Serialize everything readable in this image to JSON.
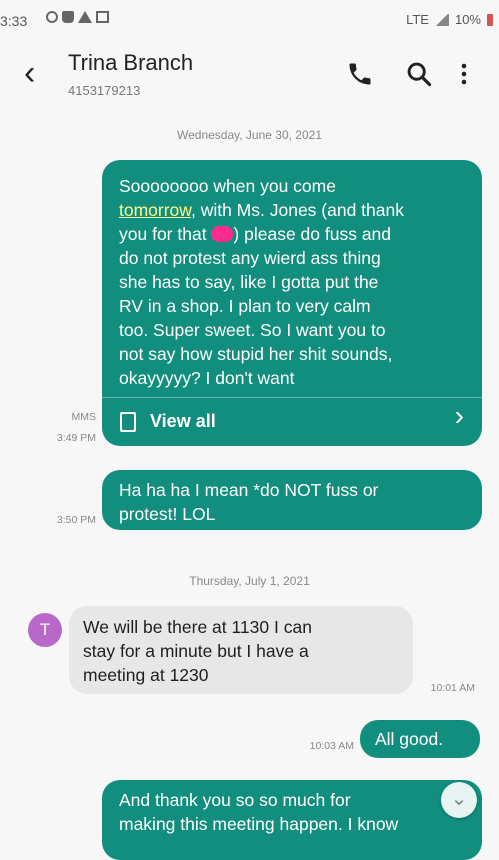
{
  "status_bar": {
    "time": "3:33",
    "network": "LTE",
    "battery": "10%"
  },
  "header": {
    "contact_name": "Trina Branch",
    "phone_number": "4153179213",
    "icons": [
      "back-icon",
      "phone-icon",
      "search-icon",
      "more-vertical-icon"
    ]
  },
  "conversation": {
    "date_1": "Wednesday, June 30, 2021",
    "message_1": {
      "line_1": "Soooooooo when you come",
      "link_text": "tomorrow",
      "after_link": ", with Ms. Jones (and thank",
      "line_3_prefix": "you for that ",
      "line_3_suffix": ") please do fuss and",
      "line_4": "do not protest any wierd ass thing",
      "line_5": "she has to say, like I gotta put the",
      "line_6": "RV in a shop.  I plan to very calm",
      "line_7": "too.  Super sweet.  So I want you to",
      "line_8": "not say how stupid her shit sounds,",
      "line_9": "okayyyyy?  I don't want",
      "view_all_label": "View all",
      "type": "MMS",
      "time": "3:49 PM"
    },
    "message_2": {
      "line_1": "Ha ha ha I mean *do NOT fuss or",
      "line_2": "protest!  LOL",
      "time": "3:50 PM"
    },
    "date_2": "Thursday, July 1, 2021",
    "message_3": {
      "avatar_letter": "T",
      "line_1": "We will be there at 1130 I can",
      "line_2": "stay for a minute but I have a",
      "line_3": "meeting at 1230",
      "time": "10:01 AM"
    },
    "message_4": {
      "text": "All good.",
      "time": "10:03 AM"
    },
    "message_5": {
      "line_1": "And thank you so so much for",
      "line_2": "making this meeting happen. I know"
    }
  }
}
